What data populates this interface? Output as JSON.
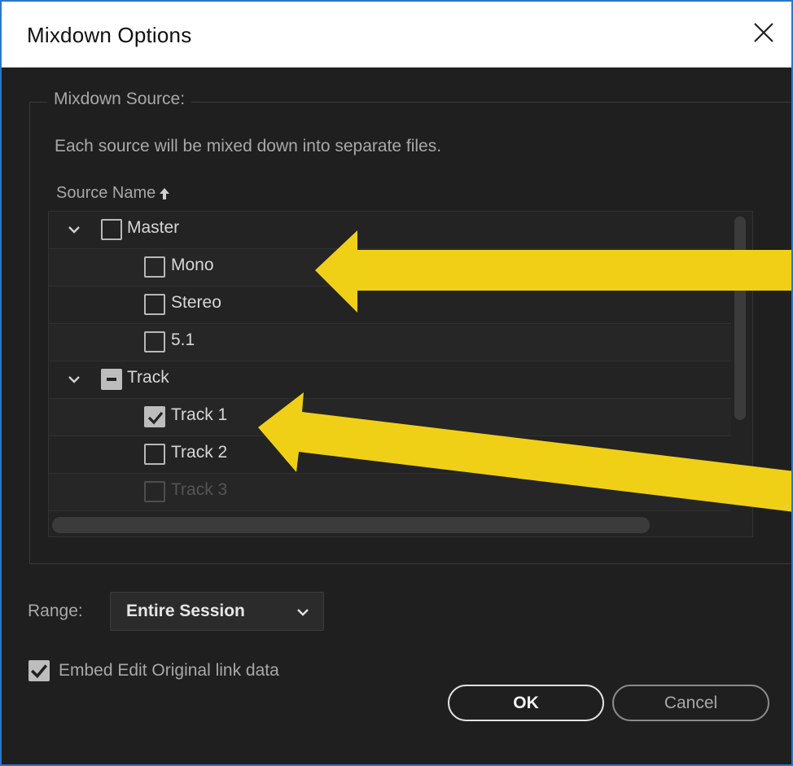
{
  "window": {
    "title": "Mixdown Options"
  },
  "source": {
    "legend": "Mixdown Source:",
    "description": "Each source will be mixed down into separate files.",
    "column_header": "Source Name",
    "rows": [
      {
        "label": "Master",
        "level": 0,
        "expanded": true,
        "state": "unchecked"
      },
      {
        "label": "Mono",
        "level": 1,
        "state": "unchecked"
      },
      {
        "label": "Stereo",
        "level": 1,
        "state": "unchecked"
      },
      {
        "label": "5.1",
        "level": 1,
        "state": "unchecked"
      },
      {
        "label": "Track",
        "level": 0,
        "expanded": true,
        "state": "mixed"
      },
      {
        "label": "Track 1",
        "level": 1,
        "state": "checked"
      },
      {
        "label": "Track 2",
        "level": 1,
        "state": "unchecked"
      },
      {
        "label": "Track 3",
        "level": 1,
        "state": "disabled"
      }
    ]
  },
  "range": {
    "label": "Range:",
    "value": "Entire Session"
  },
  "embed": {
    "label": "Embed Edit Original link data",
    "checked": true
  },
  "buttons": {
    "ok": "OK",
    "cancel": "Cancel"
  },
  "annotation": {
    "arrow_color": "#f0d017"
  }
}
